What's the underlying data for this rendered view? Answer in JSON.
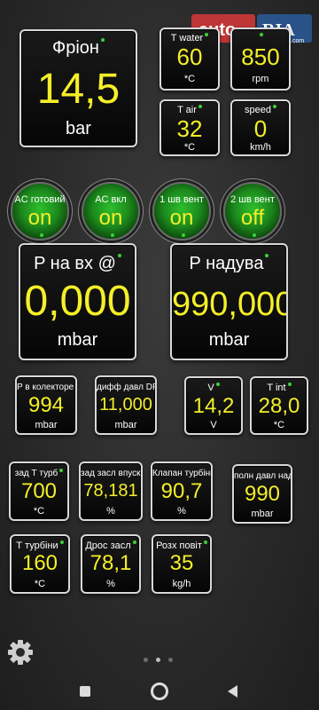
{
  "watermark": {
    "left": "auto",
    "right": "RIA",
    "sub": ".com"
  },
  "gauges_large": [
    {
      "label": "Фріон",
      "value": "14,5",
      "unit": "bar"
    },
    {
      "label": "P на вх @",
      "value": "0,000",
      "unit": "mbar"
    },
    {
      "label": "P надува",
      "value": "990,000",
      "unit": "mbar"
    }
  ],
  "gauges_small_top": [
    {
      "label": "T water",
      "value": "60",
      "unit": "*C"
    },
    {
      "label": "rpm_label",
      "value": "850",
      "unit": "rpm"
    },
    {
      "label": "T air",
      "value": "32",
      "unit": "*C"
    },
    {
      "label": "speed",
      "value": "0",
      "unit": "km/h"
    }
  ],
  "leds": [
    {
      "label": "AC готовий",
      "value": "on"
    },
    {
      "label": "AC вкл",
      "value": "on"
    },
    {
      "label": "1 шв вент",
      "value": "on"
    },
    {
      "label": "2 шв вент",
      "value": "off"
    }
  ],
  "row1": [
    {
      "label": "P в колекторе",
      "value": "994",
      "unit": "mbar"
    },
    {
      "label": "дифф давл DPF",
      "value": "11,000",
      "unit": "mbar"
    },
    {
      "label": "V",
      "value": "14,2",
      "unit": "V"
    },
    {
      "label": "T int",
      "value": "28,0",
      "unit": "*C"
    }
  ],
  "row2": [
    {
      "label": "зад Т турб",
      "value": "700",
      "unit": "*C"
    },
    {
      "label": "зад засл впуска",
      "value": "78,181",
      "unit": "%"
    },
    {
      "label": "Клапан турбіни",
      "value": "90,7",
      "unit": "%"
    },
    {
      "label": "полн давл наддува",
      "value": "990",
      "unit": "mbar"
    }
  ],
  "row3": [
    {
      "label": "Т турбіни",
      "value": "160",
      "unit": "*C"
    },
    {
      "label": "Дрос засл",
      "value": "78,1",
      "unit": "%"
    },
    {
      "label": "Розх повіт",
      "value": "35",
      "unit": "kg/h"
    }
  ],
  "nav": {
    "settings_icon": "gear-icon",
    "page_dots": 3,
    "active_page": 2
  },
  "colors": {
    "value": "#f4ef28",
    "led_green": "#2fbf2f",
    "indicator": "#3ad23a"
  }
}
